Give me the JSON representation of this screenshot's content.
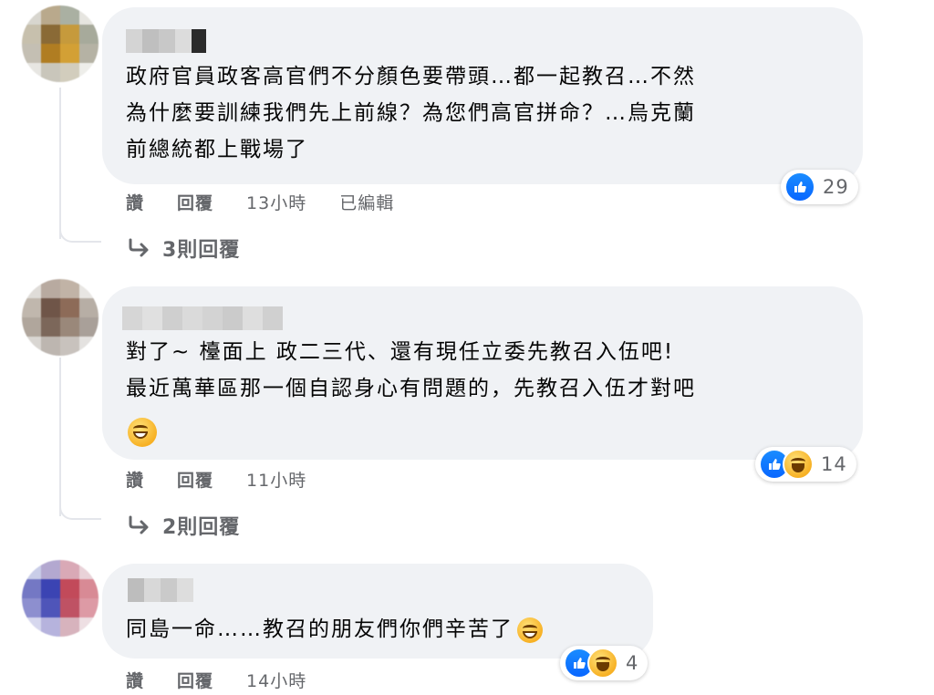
{
  "comments": [
    {
      "text": "政府官員政客高官們不分顏色要帶頭…都一起教召…不然\n為什麼要訓練我們先上前線？為您們高官拼命？…烏克蘭\n前總統都上戰場了",
      "reaction_count": "29",
      "reactions": [
        "like"
      ],
      "actions": {
        "like": "讚",
        "reply": "回覆",
        "time": "13小時",
        "edited": "已編輯"
      },
      "replies_label": "3則回覆"
    },
    {
      "text": "對了~ 檯面上 政二三代、還有現任立委先教召入伍吧!\n最近萬華區那一個自認身心有問題的，先教召入伍才對吧",
      "reaction_count": "14",
      "reactions": [
        "like",
        "haha"
      ],
      "actions": {
        "like": "讚",
        "reply": "回覆",
        "time": "11小時"
      },
      "replies_label": "2則回覆"
    },
    {
      "text": "同島一命……教召的朋友們你們辛苦了",
      "reaction_count": "4",
      "reactions": [
        "like",
        "haha"
      ],
      "actions": {
        "like": "讚",
        "reply": "回覆",
        "time": "14小時"
      }
    }
  ],
  "colors": {
    "bubble": "#f0f2f5",
    "meta_text": "#65676b",
    "like_blue": "#0866ff",
    "haha_yellow": "#f7b125"
  },
  "icons": [
    "reply-arrow-icon",
    "like-reaction-icon",
    "haha-reaction-icon",
    "grinning-emoji-icon"
  ]
}
